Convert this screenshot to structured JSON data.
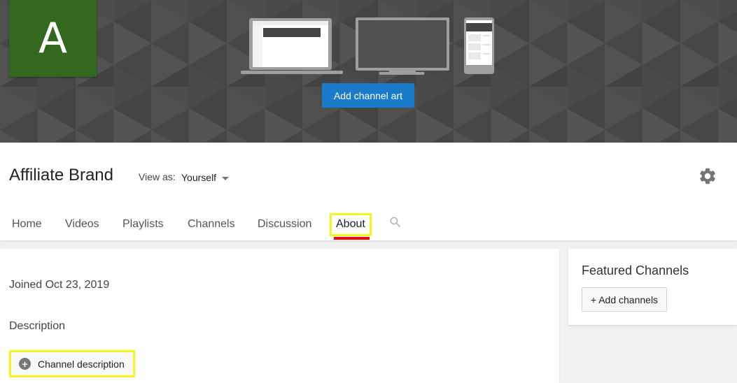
{
  "banner": {
    "avatar_letter": "A",
    "avatar_color": "#33691e",
    "add_art_label": "Add channel art",
    "button_color": "#1a7bca"
  },
  "header": {
    "channel_name": "Affiliate Brand",
    "view_as_label": "View as:",
    "view_as_value": "Yourself",
    "settings_icon": "gear-icon"
  },
  "tabs": {
    "items": [
      {
        "label": "Home"
      },
      {
        "label": "Videos"
      },
      {
        "label": "Playlists"
      },
      {
        "label": "Channels"
      },
      {
        "label": "Discussion"
      },
      {
        "label": "About",
        "active": true
      }
    ],
    "search_icon": "search-icon",
    "active_color": "#ff0000",
    "highlight_color": "#f5f51a"
  },
  "about": {
    "joined": "Joined Oct 23, 2019",
    "description_heading": "Description",
    "channel_description_button": "Channel description"
  },
  "featured": {
    "title": "Featured Channels",
    "add_button": "+ Add channels"
  }
}
